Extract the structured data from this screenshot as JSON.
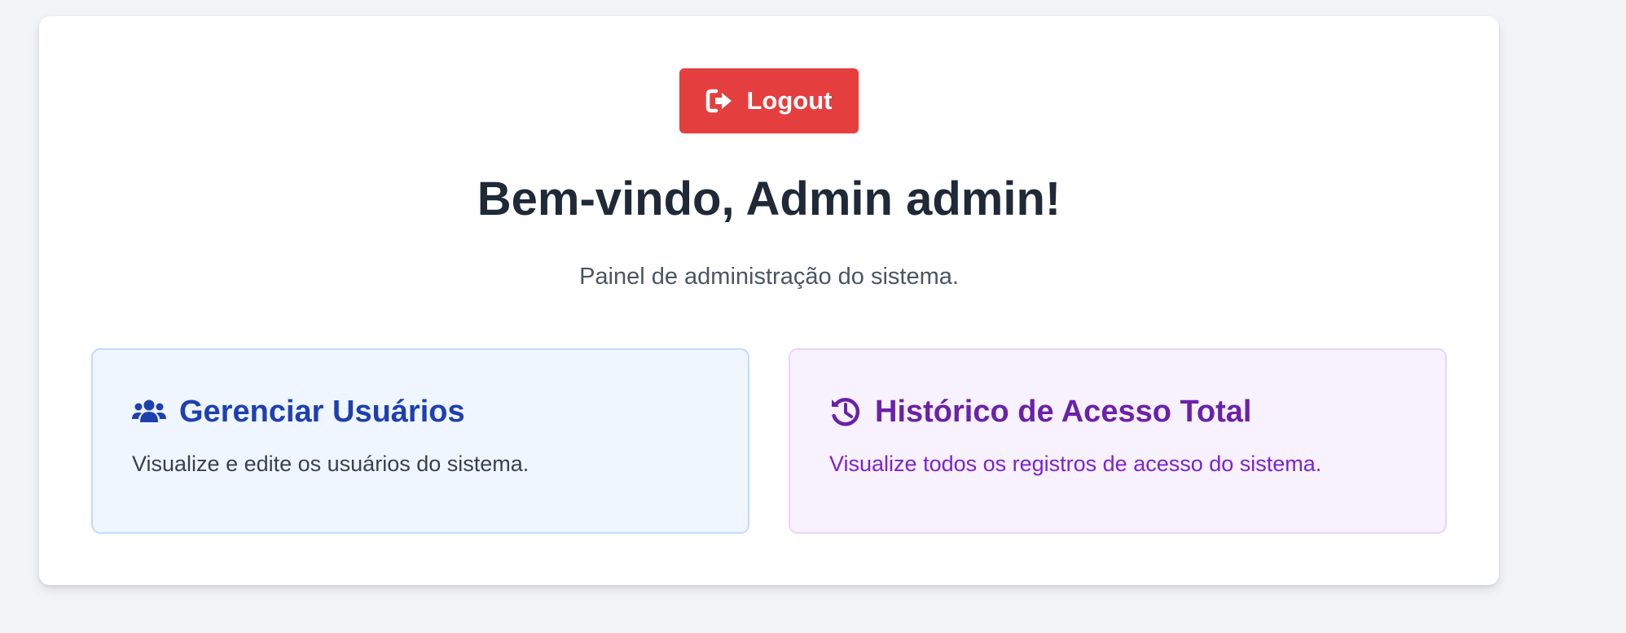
{
  "colors": {
    "page_background": "#f3f4f6",
    "card_background": "#ffffff",
    "logout_button": "#e53e3e",
    "title_text": "#1f2937",
    "subtitle_text": "#4b5563",
    "users_tile_background": "#eff6ff",
    "users_tile_border": "#bfdbfe",
    "users_tile_title": "#1e40af",
    "history_tile_background": "#f7f2fd",
    "history_tile_border": "#e9d5fb",
    "history_tile_title": "#6b21a8",
    "history_tile_desc": "#7e22ce"
  },
  "header": {
    "logout_label": "Logout",
    "logout_icon": "sign-out-icon",
    "title": "Bem-vindo, Admin admin!",
    "subtitle": "Painel de administração do sistema."
  },
  "tiles": [
    {
      "title": "Gerenciar Usuários",
      "description": "Visualize e edite os usuários do sistema.",
      "icon": "users-icon"
    },
    {
      "title": "Histórico de Acesso Total",
      "description": "Visualize todos os registros de acesso do sistema.",
      "icon": "history-icon"
    }
  ]
}
